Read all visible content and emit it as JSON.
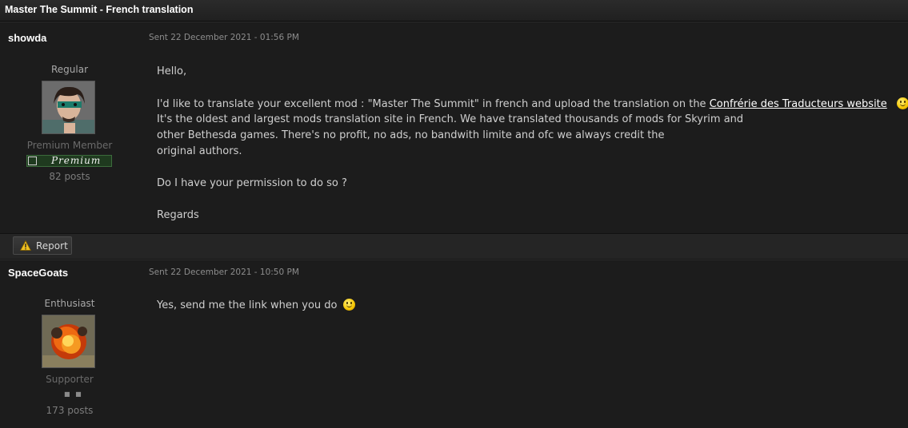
{
  "thread": {
    "title": "Master The Summit - French translation"
  },
  "posts": [
    {
      "username": "showda",
      "sent": "Sent 22 December 2021 - 01:56 PM",
      "rank": "Regular",
      "group": "Premium Member",
      "badge": "Premium",
      "post_count": "82 posts",
      "lines": {
        "l1": "Hello,",
        "l2a": "I'd like to translate your excellent mod : \"Master The Summit\" in french and upload the translation on the ",
        "l2link": "Confrérie des Traducteurs website",
        "l3": "It's the oldest and largest mods translation site in French. We have translated thousands of mods for Skyrim and",
        "l4": "other Bethesda games. There's no profit, no ads, no bandwith limite and ofc we always credit the",
        "l5": "original authors.",
        "l6": "Do I have your permission to do so ?",
        "l7": "Regards"
      },
      "report_label": "Report"
    },
    {
      "username": "SpaceGoats",
      "sent": "Sent 22 December 2021 - 10:50 PM",
      "rank": "Enthusiast",
      "group": "Supporter",
      "post_count": "173 posts",
      "lines": {
        "l1": "Yes, send me the link when you do"
      }
    }
  ],
  "icons": {
    "smiley": "smiley-icon",
    "warning": "warning-icon",
    "premium": "premium-badge-icon"
  },
  "colors": {
    "background": "#181818",
    "link": "#ffffff",
    "badge": "#1f3a1f"
  }
}
